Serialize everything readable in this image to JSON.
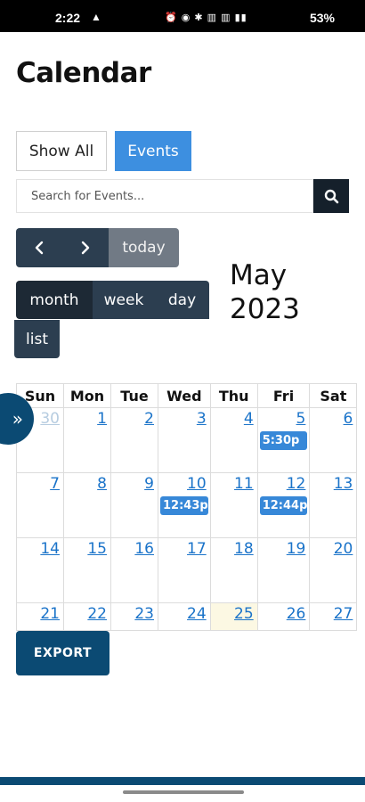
{
  "status_bar": {
    "time": "2:22",
    "icons_text": "⏰ ◉ ✱ ▥ ▥ ▮▮",
    "battery": "53%"
  },
  "page": {
    "title": "Calendar"
  },
  "filters": {
    "show_all": "Show All",
    "events": "Events"
  },
  "search": {
    "placeholder": "Search for Events..."
  },
  "nav": {
    "today": "today"
  },
  "views": {
    "month": "month",
    "week": "week",
    "day": "day",
    "list": "list"
  },
  "calendar": {
    "month_title": "May 2023",
    "weekdays": [
      "Sun",
      "Mon",
      "Tue",
      "Wed",
      "Thu",
      "Fri",
      "Sat"
    ],
    "weeks": [
      {
        "days": [
          {
            "num": "30",
            "other": true
          },
          {
            "num": "1"
          },
          {
            "num": "2"
          },
          {
            "num": "3"
          },
          {
            "num": "4"
          },
          {
            "num": "5",
            "event": "5:30p"
          },
          {
            "num": "6"
          }
        ]
      },
      {
        "days": [
          {
            "num": "7"
          },
          {
            "num": "8"
          },
          {
            "num": "9"
          },
          {
            "num": "10",
            "event": "12:43p"
          },
          {
            "num": "11"
          },
          {
            "num": "12",
            "event": "12:44p"
          },
          {
            "num": "13"
          }
        ]
      },
      {
        "days": [
          {
            "num": "14"
          },
          {
            "num": "15"
          },
          {
            "num": "16"
          },
          {
            "num": "17"
          },
          {
            "num": "18"
          },
          {
            "num": "19"
          },
          {
            "num": "20"
          }
        ]
      },
      {
        "days": [
          {
            "num": "21"
          },
          {
            "num": "22"
          },
          {
            "num": "23"
          },
          {
            "num": "24"
          },
          {
            "num": "25",
            "today": true
          },
          {
            "num": "26"
          },
          {
            "num": "27"
          }
        ]
      }
    ],
    "side_toggle": "»"
  },
  "export": {
    "label": "EXPORT"
  },
  "colors": {
    "accent": "#3d8fe0",
    "dark_button": "#2c3e50",
    "brand": "#0b4a73",
    "today_bg": "#fcf8e3"
  }
}
